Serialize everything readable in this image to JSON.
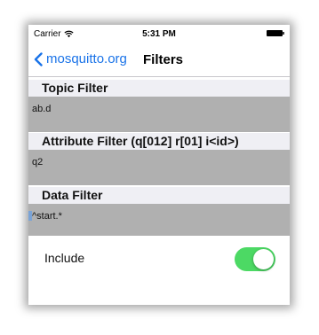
{
  "status_bar": {
    "carrier": "Carrier",
    "time": "5:31 PM",
    "wifi_icon": "wifi-icon",
    "battery_icon": "battery-icon"
  },
  "nav": {
    "back_label": "mosquitto.org",
    "back_icon": "chevron-left-icon",
    "title": "Filters"
  },
  "sections": {
    "topic": {
      "header": "Topic Filter",
      "value": "ab.d"
    },
    "attribute": {
      "header": "Attribute Filter (q[012] r[01] i<id>)",
      "value": "q2"
    },
    "data": {
      "header": "Data Filter",
      "value": "^start.*"
    }
  },
  "include": {
    "label": "Include",
    "enabled": true
  },
  "colors": {
    "accent": "#1a73e8",
    "toggle_on": "#4cd964",
    "field_bg": "#b0b0b0",
    "header_bg": "#efeff4"
  }
}
